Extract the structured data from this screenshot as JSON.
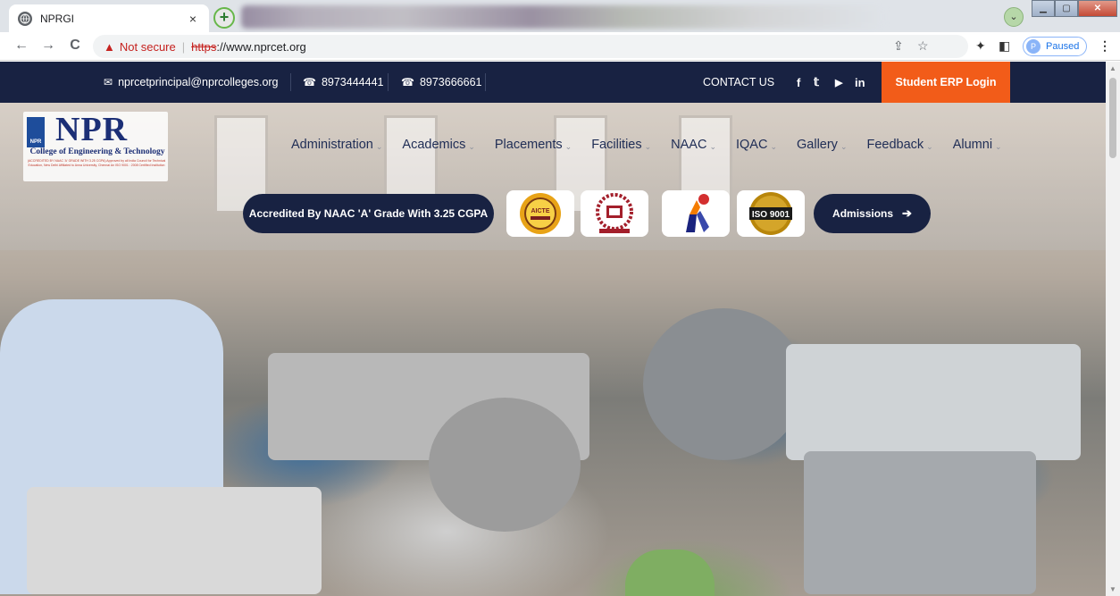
{
  "browser": {
    "tab_title": "NPRGI",
    "tab_close": "×",
    "new_tab": "+",
    "nav": {
      "back": "←",
      "forward": "→",
      "reload": "C"
    },
    "omnibox": {
      "not_secure": "Not secure",
      "separator": "|",
      "scheme": "https",
      "rest": "://www.nprcet.org"
    },
    "profile_initial": "P",
    "profile_status": "Paused",
    "menu": "⋮"
  },
  "topbar": {
    "email": "nprcetprincipal@nprcolleges.org",
    "phone1": "8973444441",
    "phone2": "8973666661",
    "contact": "CONTACT US",
    "social": {
      "facebook": "f",
      "twitter": "𝕥",
      "youtube": "▶",
      "linkedin": "in"
    },
    "erp_login": "Student ERP Login"
  },
  "logo": {
    "name": "NPR",
    "college": "College of Engineering & Technology",
    "emblem": "NPR",
    "smallprint": "(ACCREDITED BY NAAC 'A' GRADE WITH 3.25 CGPA) Approved by all India Council for Technical Education, New Delhi Affiliated to Anna University, Chennai An ISO 9001 : 2008 Certified Institution"
  },
  "nav": {
    "items": [
      {
        "label": "Administration",
        "dropdown": true
      },
      {
        "label": "Academics",
        "dropdown": true
      },
      {
        "label": "Placements",
        "dropdown": true
      },
      {
        "label": "Facilities",
        "dropdown": true
      },
      {
        "label": "NAAC",
        "dropdown": true
      },
      {
        "label": "IQAC",
        "dropdown": true
      },
      {
        "label": "Gallery",
        "dropdown": true
      },
      {
        "label": "Feedback",
        "dropdown": true
      },
      {
        "label": "Alumni",
        "dropdown": true
      }
    ]
  },
  "banner": {
    "naac": "Accredited By NAAC 'A' Grade With 3.25 CGPA",
    "badges": [
      "aicte-logo",
      "anna-university-logo",
      "nirf-logo",
      "iso-9001-logo"
    ],
    "badge_text": {
      "aicte": "AICTE",
      "iso": "ISO 9001"
    },
    "admissions": "Admissions",
    "admissions_arrow": "➔"
  },
  "colors": {
    "navy": "#182242",
    "orange": "#f25c19",
    "nav_text": "#1f2d55"
  }
}
